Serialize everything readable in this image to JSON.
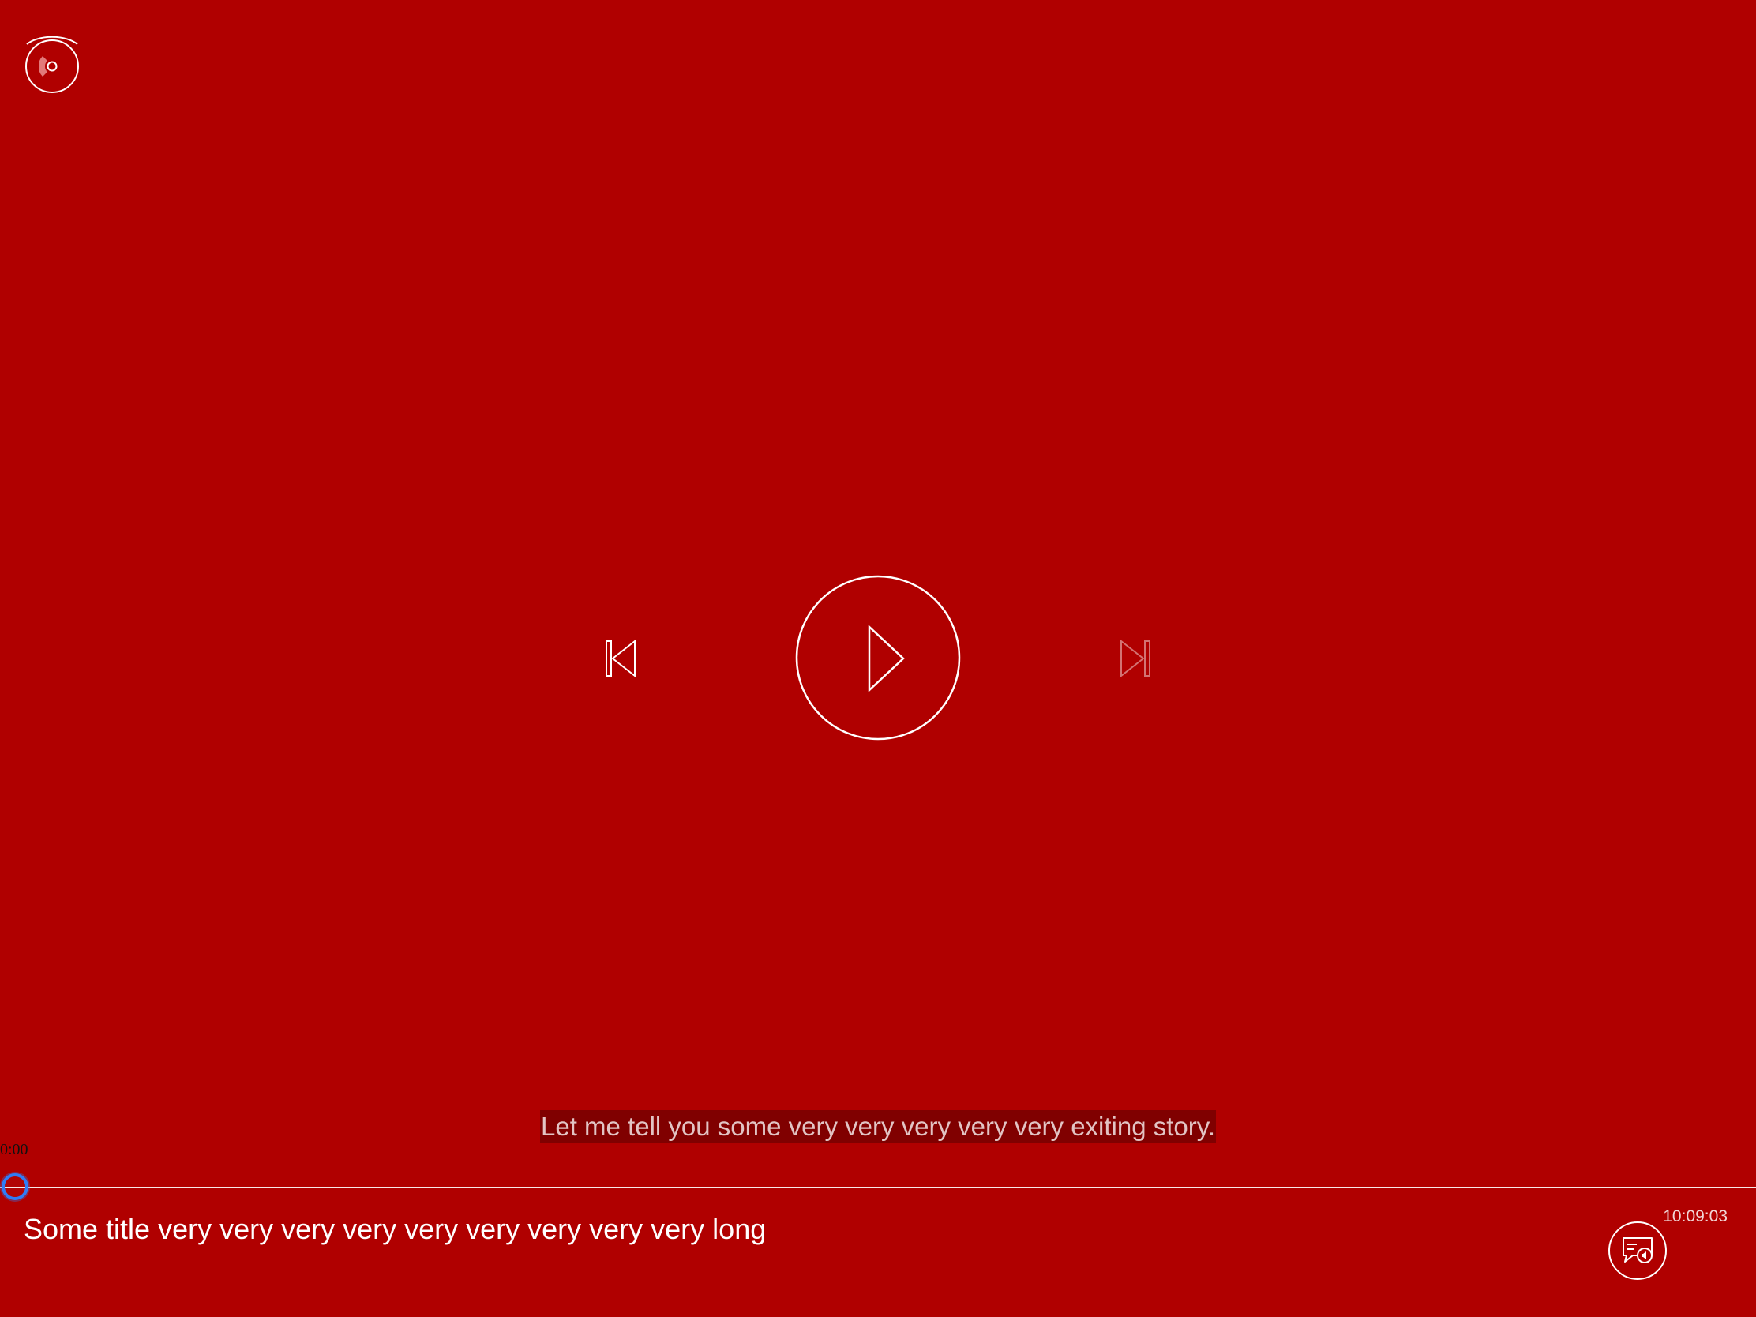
{
  "player": {
    "subtitle_text": "Let me tell you some very very very very very exiting story.",
    "elapsed_time": "0:00",
    "total_time": "10:09:03",
    "track_title": "Some title very very very very very very very very very long",
    "progress": 0.0,
    "next_enabled": false
  },
  "icons": {
    "top_left": "disc-icon",
    "previous": "skip-previous-icon",
    "play": "play-icon",
    "next": "skip-next-icon",
    "subtitles": "subtitles-audio-icon"
  },
  "colors": {
    "background": "#b00000",
    "foreground": "#ffffff",
    "accent": "#2f7cf6"
  }
}
